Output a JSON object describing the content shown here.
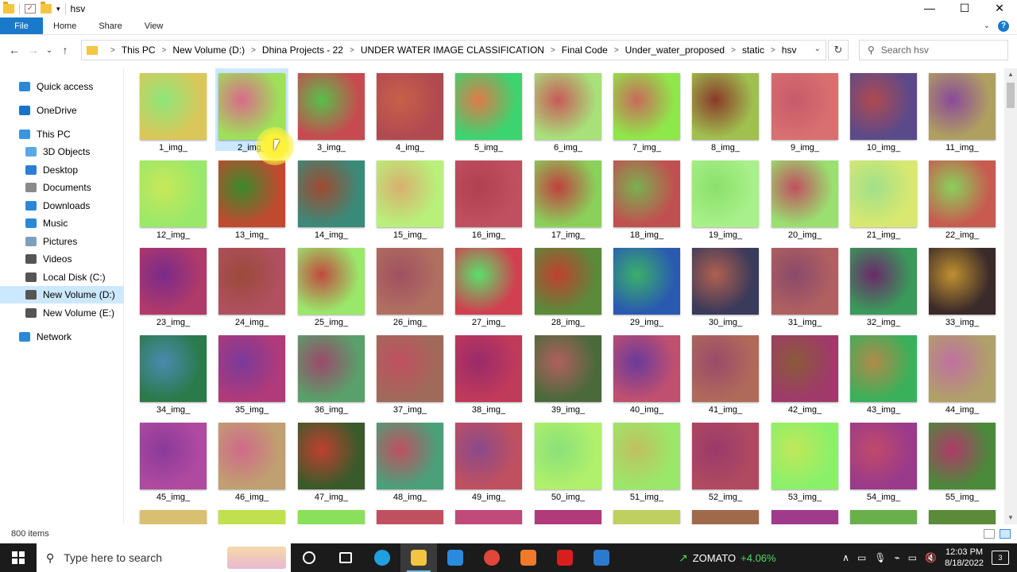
{
  "window": {
    "title": "hsv",
    "controls": {
      "minimize": "—",
      "maximize": "☐",
      "close": "✕"
    }
  },
  "ribbon": {
    "tabs": [
      "File",
      "Home",
      "Share",
      "View"
    ],
    "help": "?",
    "expand": "⌄"
  },
  "address": {
    "crumbs": [
      "This PC",
      "New Volume (D:)",
      "Dhina Projects - 22",
      "UNDER WATER IMAGE CLASSIFICATION",
      "Final Code",
      "Under_water_proposed",
      "static",
      "hsv"
    ],
    "search_placeholder": "Search hsv",
    "back": "←",
    "forward": "→",
    "recent": "⌄",
    "up": "↑",
    "refresh": "↻",
    "dropdown": "⌄"
  },
  "sidebar": {
    "items": [
      {
        "label": "Quick access",
        "icon": "star-icon",
        "color": "#2b88d8"
      },
      {
        "label": "OneDrive",
        "icon": "cloud-icon",
        "color": "#1a73c9"
      },
      {
        "label": "This PC",
        "icon": "computer-icon",
        "color": "#3a95e0"
      },
      {
        "label": "3D Objects",
        "icon": "cube-icon",
        "color": "#5aa9e6"
      },
      {
        "label": "Desktop",
        "icon": "desktop-icon",
        "color": "#2d7fd3"
      },
      {
        "label": "Documents",
        "icon": "documents-icon",
        "color": "#8a8a8a"
      },
      {
        "label": "Downloads",
        "icon": "downloads-icon",
        "color": "#2b88d8"
      },
      {
        "label": "Music",
        "icon": "music-icon",
        "color": "#2b88d8"
      },
      {
        "label": "Pictures",
        "icon": "pictures-icon",
        "color": "#7f9fbf"
      },
      {
        "label": "Videos",
        "icon": "videos-icon",
        "color": "#555555"
      },
      {
        "label": "Local Disk (C:)",
        "icon": "drive-icon",
        "color": "#555555"
      },
      {
        "label": "New Volume (D:)",
        "icon": "drive-icon",
        "color": "#555555"
      },
      {
        "label": "New Volume (E:)",
        "icon": "drive-icon",
        "color": "#555555"
      },
      {
        "label": "Network",
        "icon": "network-icon",
        "color": "#2b88d8"
      }
    ],
    "selected_index": 11
  },
  "files": {
    "names": [
      "1_img_",
      "2_img_",
      "3_img_",
      "4_img_",
      "5_img_",
      "6_img_",
      "7_img_",
      "8_img_",
      "9_img_",
      "10_img_",
      "11_img_",
      "12_img_",
      "13_img_",
      "14_img_",
      "15_img_",
      "16_img_",
      "17_img_",
      "18_img_",
      "19_img_",
      "20_img_",
      "21_img_",
      "22_img_",
      "23_img_",
      "24_img_",
      "25_img_",
      "26_img_",
      "27_img_",
      "28_img_",
      "29_img_",
      "30_img_",
      "31_img_",
      "32_img_",
      "33_img_",
      "34_img_",
      "35_img_",
      "36_img_",
      "37_img_",
      "38_img_",
      "39_img_",
      "40_img_",
      "41_img_",
      "42_img_",
      "43_img_",
      "44_img_",
      "45_img_",
      "46_img_",
      "47_img_",
      "48_img_",
      "49_img_",
      "50_img_",
      "51_img_",
      "52_img_",
      "53_img_",
      "54_img_",
      "55_img_"
    ],
    "selected": "2_img_",
    "thumb_colors": [
      [
        "#d9c75a",
        "#8ee67a"
      ],
      [
        "#9fe05a",
        "#d96a8a"
      ],
      [
        "#c74a50",
        "#58c04a"
      ],
      [
        "#b04a50",
        "#c9604a"
      ],
      [
        "#3bd470",
        "#e07a4a"
      ],
      [
        "#a8e07a",
        "#c85a5a"
      ],
      [
        "#8fe84a",
        "#c96a5a"
      ],
      [
        "#a0c050",
        "#8a3a2a"
      ],
      [
        "#d87070",
        "#c85a6a"
      ],
      [
        "#5a4a8a",
        "#b04a50"
      ],
      [
        "#b0a060",
        "#8a4a9a"
      ],
      [
        "#9ae86a",
        "#c8e85a"
      ],
      [
        "#c04a30",
        "#3a8a2a"
      ],
      [
        "#3a8a7a",
        "#a04a30"
      ],
      [
        "#b9f07a",
        "#d8b070"
      ],
      [
        "#c05060",
        "#b04050"
      ],
      [
        "#8ad05a",
        "#c04040"
      ],
      [
        "#c05050",
        "#7ab050"
      ],
      [
        "#a8f08a",
        "#8ae06a"
      ],
      [
        "#9ae070",
        "#c05060"
      ],
      [
        "#d8e870",
        "#a0e08a"
      ],
      [
        "#c85a50",
        "#8ad05a"
      ],
      [
        "#b03a6a",
        "#7a2a8a"
      ],
      [
        "#b05060",
        "#9a4a3a"
      ],
      [
        "#9ae86a",
        "#c04a40"
      ],
      [
        "#b07060",
        "#a05060"
      ],
      [
        "#d04050",
        "#5ae06a"
      ],
      [
        "#5a8a3a",
        "#c04030"
      ],
      [
        "#2a5ab0",
        "#3ab06a"
      ],
      [
        "#3a3a5a",
        "#b06050"
      ],
      [
        "#b06060",
        "#8a4a6a"
      ],
      [
        "#3a9a5a",
        "#6a2a6a"
      ],
      [
        "#3a2a2a",
        "#c09030"
      ],
      [
        "#2a7a4a",
        "#4a8ab0"
      ],
      [
        "#b03a7a",
        "#7a3a9a"
      ],
      [
        "#5aa06a",
        "#9a4a6a"
      ],
      [
        "#a06a5a",
        "#c05060"
      ],
      [
        "#c03a5a",
        "#9a2a6a"
      ],
      [
        "#4a6a3a",
        "#b06060"
      ],
      [
        "#c05070",
        "#6a3a9a"
      ],
      [
        "#b06a5a",
        "#9a4a6a"
      ],
      [
        "#a03a6a",
        "#8a5a3a"
      ],
      [
        "#3ab05a",
        "#b08a4a"
      ],
      [
        "#b0a06a",
        "#c070a0"
      ],
      [
        "#b04aa0",
        "#8a3a9a"
      ],
      [
        "#c0a070",
        "#d06a8a"
      ],
      [
        "#3a5a2a",
        "#c04030"
      ],
      [
        "#4aa07a",
        "#c05060"
      ],
      [
        "#c05060",
        "#8a4a8a"
      ],
      [
        "#b0f06a",
        "#8ae07a"
      ],
      [
        "#9ae86a",
        "#c0c060"
      ],
      [
        "#b04a60",
        "#9a3a6a"
      ],
      [
        "#8af06a",
        "#c0e85a"
      ],
      [
        "#9a3a8a",
        "#c04a6a"
      ],
      [
        "#4a8a3a",
        "#b03a6a"
      ]
    ],
    "partial_row_colors": [
      "#d8c070",
      "#c0e050",
      "#8ae05a",
      "#c05060",
      "#c04a7a",
      "#b03a7a",
      "#c0d060",
      "#a06a4a",
      "#a03a8a",
      "#6ab04a",
      "#5a8a3a"
    ]
  },
  "status": {
    "item_count": "800 items"
  },
  "taskbar": {
    "search_placeholder": "Type here to search",
    "apps": [
      {
        "name": "task-view",
        "color": "#ffffff"
      },
      {
        "name": "edge",
        "color": "#1f9fe0"
      },
      {
        "name": "file-explorer",
        "color": "#f4c542"
      },
      {
        "name": "vscode",
        "color": "#2a8ae0"
      },
      {
        "name": "chrome",
        "color": "#e0463a"
      },
      {
        "name": "xampp",
        "color": "#f07a2a"
      },
      {
        "name": "acrobat",
        "color": "#d81e1e"
      },
      {
        "name": "photos",
        "color": "#2a7ad0"
      }
    ],
    "ticker": {
      "symbol": "ZOMATO",
      "change": "+4.06%"
    },
    "tray": {
      "time": "12:03 PM",
      "date": "8/18/2022",
      "notifications": "3"
    }
  }
}
